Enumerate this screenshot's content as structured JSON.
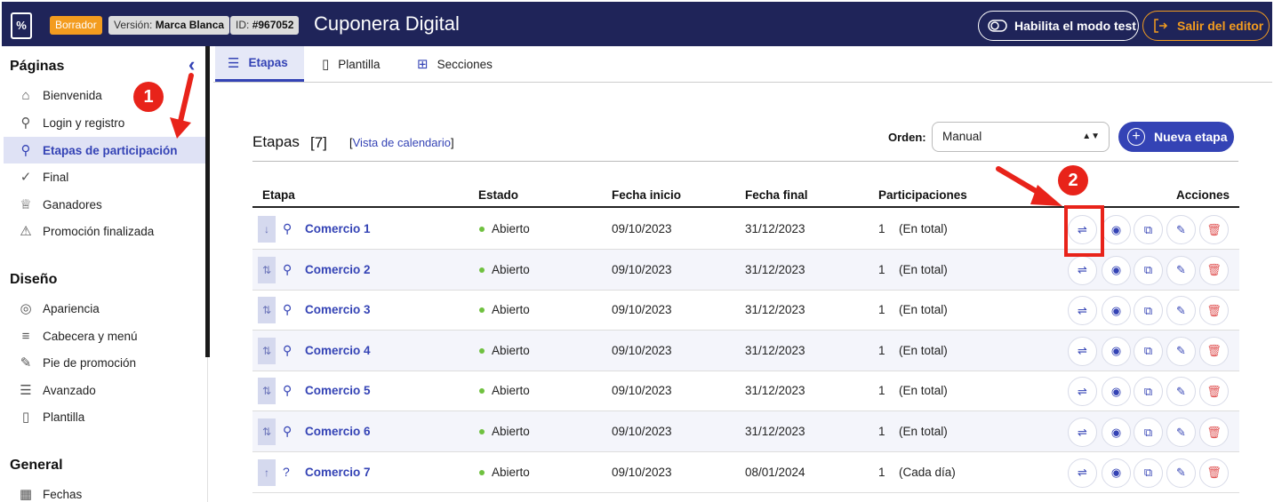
{
  "header": {
    "logo_glyph": "%",
    "draft_badge": "Borrador",
    "version_label": "Versión:",
    "version_value": "Marca Blanca",
    "id_label": "ID:",
    "id_value": "#967052",
    "title": "Cuponera Digital",
    "test_mode_button": "Habilita el modo test",
    "exit_button": "Salir del editor"
  },
  "sidebar": {
    "sections": [
      {
        "title": "Páginas"
      },
      {
        "title": "Diseño"
      },
      {
        "title": "General"
      }
    ],
    "pages": [
      {
        "label": "Bienvenida",
        "icon": "home-icon",
        "glyph": "⌂"
      },
      {
        "label": "Login y registro",
        "icon": "user-lock-icon",
        "glyph": "⚲"
      },
      {
        "label": "Etapas de participación",
        "icon": "user-stages-icon",
        "glyph": "⚲",
        "active": true
      },
      {
        "label": "Final",
        "icon": "check-icon",
        "glyph": "✓"
      },
      {
        "label": "Ganadores",
        "icon": "trophy-icon",
        "glyph": "♕"
      },
      {
        "label": "Promoción finalizada",
        "icon": "warning-icon",
        "glyph": "⚠"
      }
    ],
    "design": [
      {
        "label": "Apariencia",
        "icon": "palette-icon",
        "glyph": "◎"
      },
      {
        "label": "Cabecera y menú",
        "icon": "menu-icon",
        "glyph": "≡"
      },
      {
        "label": "Pie de promoción",
        "icon": "brush-icon",
        "glyph": "✎"
      },
      {
        "label": "Avanzado",
        "icon": "advanced-icon",
        "glyph": "☰"
      },
      {
        "label": "Plantilla",
        "icon": "file-icon",
        "glyph": "▯"
      }
    ],
    "general": [
      {
        "label": "Fechas",
        "icon": "calendar-icon",
        "glyph": "▦"
      }
    ]
  },
  "tabs": [
    {
      "label": "Etapas",
      "icon": "list-icon",
      "glyph": "☰"
    },
    {
      "label": "Plantilla",
      "icon": "clipboard-icon",
      "glyph": "▯"
    },
    {
      "label": "Secciones",
      "icon": "grid-icon",
      "glyph": "⊞"
    }
  ],
  "list": {
    "title": "Etapas",
    "count": "[7]",
    "calendar_link": "Vista de calendario",
    "order_label": "Orden:",
    "order_value": "Manual",
    "new_button": "Nueva etapa"
  },
  "table": {
    "headers": [
      "Etapa",
      "Estado",
      "Fecha inicio",
      "Fecha final",
      "Participaciones",
      "Acciones"
    ],
    "rows": [
      {
        "drag": "↓",
        "icon_glyph": "⚲",
        "name": "Comercio 1",
        "status": "Abierto",
        "start": "09/10/2023",
        "end": "31/12/2023",
        "count": "1",
        "note": "(En total)"
      },
      {
        "drag": "⇅",
        "icon_glyph": "⚲",
        "name": "Comercio 2",
        "status": "Abierto",
        "start": "09/10/2023",
        "end": "31/12/2023",
        "count": "1",
        "note": "(En total)"
      },
      {
        "drag": "⇅",
        "icon_glyph": "⚲",
        "name": "Comercio 3",
        "status": "Abierto",
        "start": "09/10/2023",
        "end": "31/12/2023",
        "count": "1",
        "note": "(En total)"
      },
      {
        "drag": "⇅",
        "icon_glyph": "⚲",
        "name": "Comercio 4",
        "status": "Abierto",
        "start": "09/10/2023",
        "end": "31/12/2023",
        "count": "1",
        "note": "(En total)"
      },
      {
        "drag": "⇅",
        "icon_glyph": "⚲",
        "name": "Comercio 5",
        "status": "Abierto",
        "start": "09/10/2023",
        "end": "31/12/2023",
        "count": "1",
        "note": "(En total)"
      },
      {
        "drag": "⇅",
        "icon_glyph": "⚲",
        "name": "Comercio 6",
        "status": "Abierto",
        "start": "09/10/2023",
        "end": "31/12/2023",
        "count": "1",
        "note": "(En total)"
      },
      {
        "drag": "↑",
        "icon_glyph": "?",
        "name": "Comercio 7",
        "status": "Abierto",
        "start": "09/10/2023",
        "end": "08/01/2024",
        "count": "1",
        "note": "(Cada día)"
      }
    ],
    "actions": [
      {
        "name": "swap-icon",
        "glyph": "⇌"
      },
      {
        "name": "eye-icon",
        "glyph": "◉"
      },
      {
        "name": "copy-icon",
        "glyph": "⧉"
      },
      {
        "name": "pencil-icon",
        "glyph": "✎"
      },
      {
        "name": "trash-icon",
        "glyph": "🗑"
      }
    ]
  },
  "annotations": {
    "step1": "1",
    "step2": "2"
  },
  "colors": {
    "navy": "#1f2459",
    "accent": "#3443b5",
    "orange": "#f39c1f",
    "annotation_red": "#e8231a",
    "open_green": "#6fc13f"
  }
}
